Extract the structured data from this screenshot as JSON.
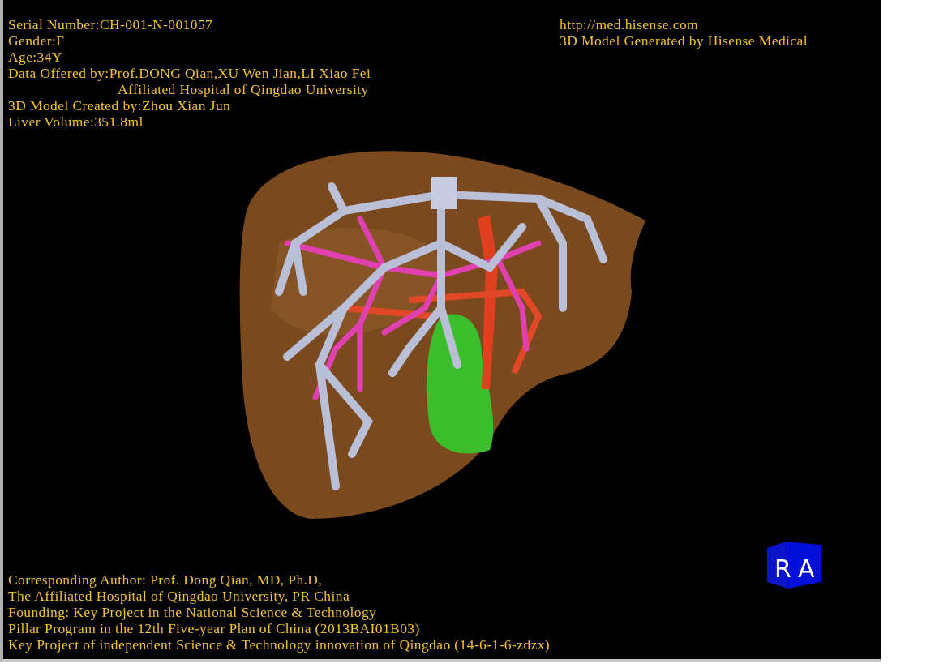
{
  "patient_info": [
    {
      "text": "Serial Number:CH-001-N-001057",
      "indented": false
    },
    {
      "text": "Gender:F",
      "indented": false
    },
    {
      "text": "Age:34Y",
      "indented": false
    },
    {
      "text": "Data Offered by:Prof.DONG Qian,XU Wen Jian,LI Xiao Fei",
      "indented": false
    },
    {
      "text": "Affiliated Hospital of Qingdao University",
      "indented": true
    },
    {
      "text": "3D Model Created by:Zhou Xian Jun",
      "indented": false
    },
    {
      "text": "Liver Volume:351.8ml",
      "indented": false
    }
  ],
  "credits": [
    "http://med.hisense.com",
    "3D Model Generated by Hisense Medical"
  ],
  "footer": [
    "Corresponding Author: Prof. Dong Qian, MD, Ph.D,",
    "The Affiliated Hospital of Qingdao University, PR China",
    "Founding: Key Project in the National Science & Technology",
    "Pillar Program in the 12th Five-year Plan of China (2013BAI01B03)",
    "Key Project of independent Science & Technology innovation of Qingdao (14-6-1-6-zdzx)"
  ],
  "orientation_cube": {
    "faces": [
      "R",
      "A"
    ]
  }
}
